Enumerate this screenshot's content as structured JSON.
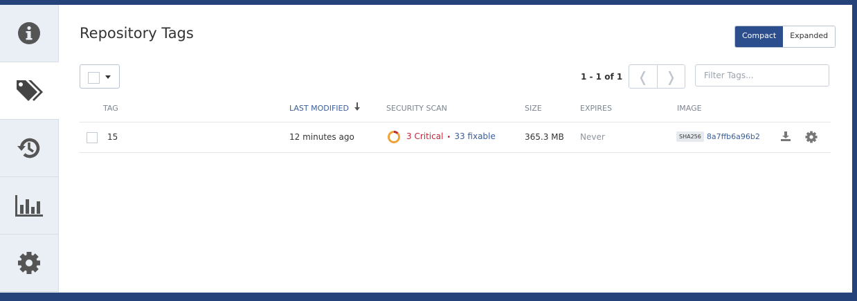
{
  "page": {
    "title": "Repository Tags"
  },
  "sidebar": {
    "items": [
      {
        "icon": "info-icon",
        "active": false
      },
      {
        "icon": "tags-icon",
        "active": true
      },
      {
        "icon": "history-icon",
        "active": false
      },
      {
        "icon": "bar-chart-icon",
        "active": false
      },
      {
        "icon": "gear-icon",
        "active": false
      }
    ]
  },
  "view_toggle": {
    "compact_label": "Compact",
    "expanded_label": "Expanded",
    "selected": "Compact"
  },
  "toolbar": {
    "pagination_text": "1 - 1 of 1",
    "filter_placeholder": "Filter Tags..."
  },
  "table": {
    "headers": {
      "tag": "TAG",
      "last_modified": "LAST MODIFIED",
      "security_scan": "SECURITY SCAN",
      "size": "SIZE",
      "expires": "EXPIRES",
      "image": "IMAGE"
    },
    "sort_column": "LAST MODIFIED",
    "rows": [
      {
        "tag": "15",
        "last_modified": "12 minutes ago",
        "scan_critical": "3 Critical",
        "scan_separator": "•",
        "scan_fixable": "33 fixable",
        "size": "365.3 MB",
        "expires": "Never",
        "digest_type": "SHA256",
        "digest": "8a7ffb6a96b2"
      }
    ]
  },
  "colors": {
    "brand_blue": "#2d4e8d",
    "critical_red": "#c0283c",
    "link_blue": "#3a5d9c",
    "scan_orange": "#f0a23a"
  }
}
